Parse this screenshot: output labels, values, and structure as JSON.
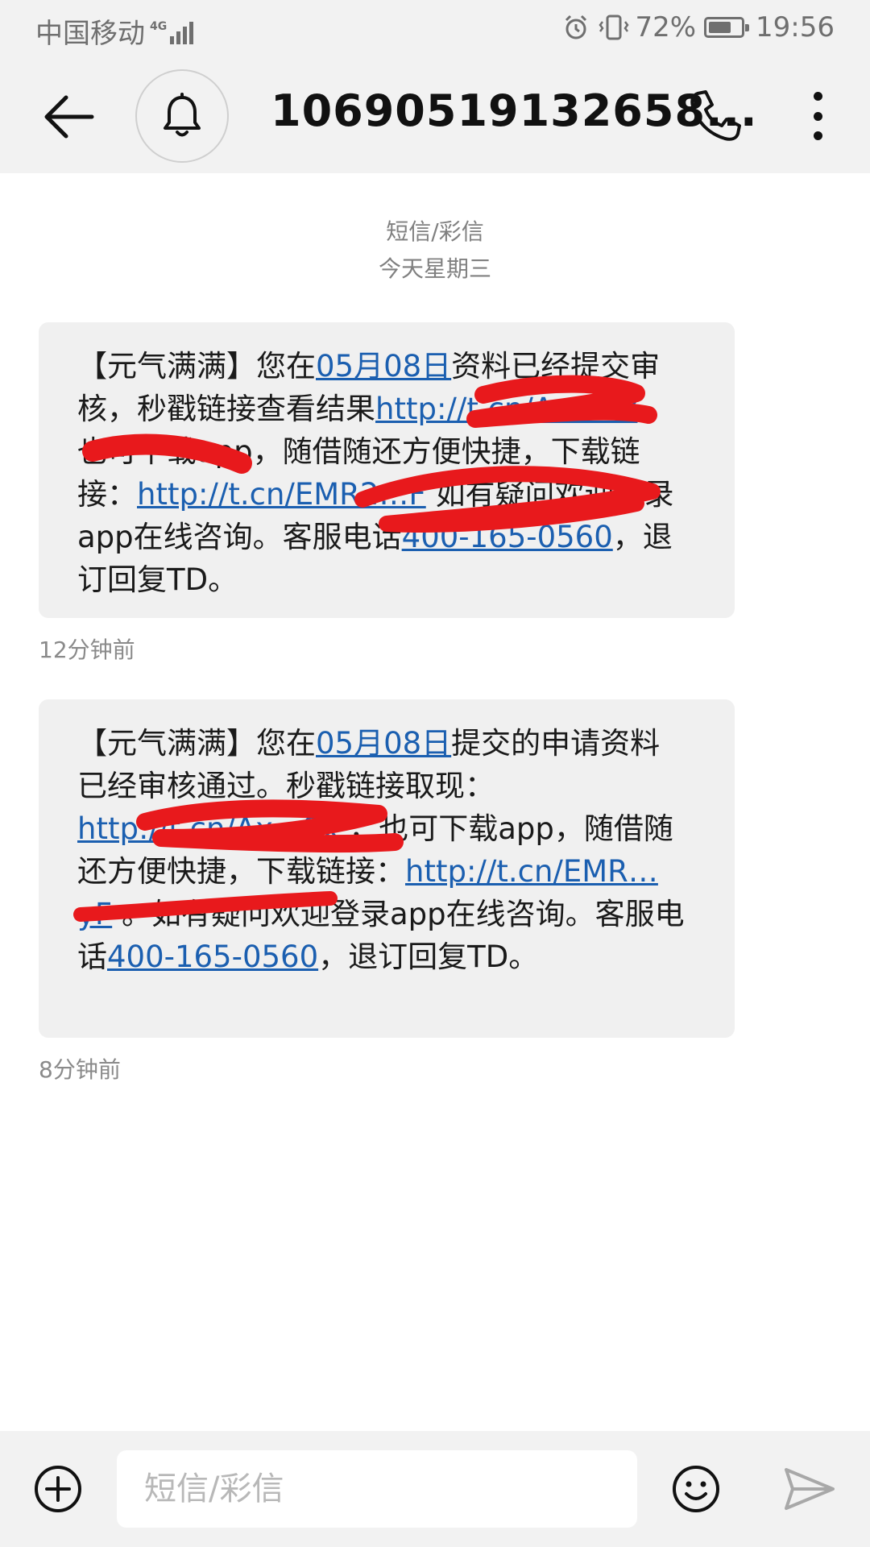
{
  "status_bar": {
    "carrier": "中国移动",
    "network": "4G",
    "battery_percent": "72%",
    "battery_level": 0.72,
    "time": "19:56"
  },
  "header": {
    "title": "10690519132658...",
    "icons": [
      "back-arrow-icon",
      "bell-icon",
      "phone-icon",
      "more-vertical-icon"
    ]
  },
  "conversation": {
    "message_type": "短信/彩信",
    "date_label": "今天星期三",
    "messages": [
      {
        "segments": {
          "s1": "【元气满满】您在",
          "date": "05月08日",
          "s2": "资料已经提交审核，秒戳链接查看结果",
          "link1": "http://t.cn/Ax…Sx",
          "s3": "，也可下载app，随借随还方便快捷，下载链接：",
          "link2": "http://t.cn/EMR2…F",
          "s4": " 如有疑问欢迎登录app在线咨询。客服电话",
          "phone": "400-165-0560",
          "s5": "，退订回复TD。"
        },
        "time": "12分钟前"
      },
      {
        "segments": {
          "s1": "【元气满满】您在",
          "date": "05月08日",
          "s2": "提交的申请资料已经审核通过。秒戳链接取现：",
          "link1": "http://t.cn/Ax…Sx",
          "s3": " ，也可下载app，随借随还方便快捷，下载链接：",
          "link2": "http://t.cn/EMR…yF",
          "s4": " 。如有疑问欢迎登录app在线咨询。客服电话",
          "phone": "400-165-0560",
          "s5": "，退订回复TD。"
        },
        "time": "8分钟前"
      }
    ]
  },
  "compose": {
    "placeholder": "短信/彩信",
    "icons": [
      "add-circle-icon",
      "emoji-icon",
      "send-icon"
    ]
  },
  "colors": {
    "bar_background": "#f2f2f2",
    "bubble_background": "#f0f0f0",
    "link": "#1b5fb0",
    "redaction": "#e8191c"
  }
}
